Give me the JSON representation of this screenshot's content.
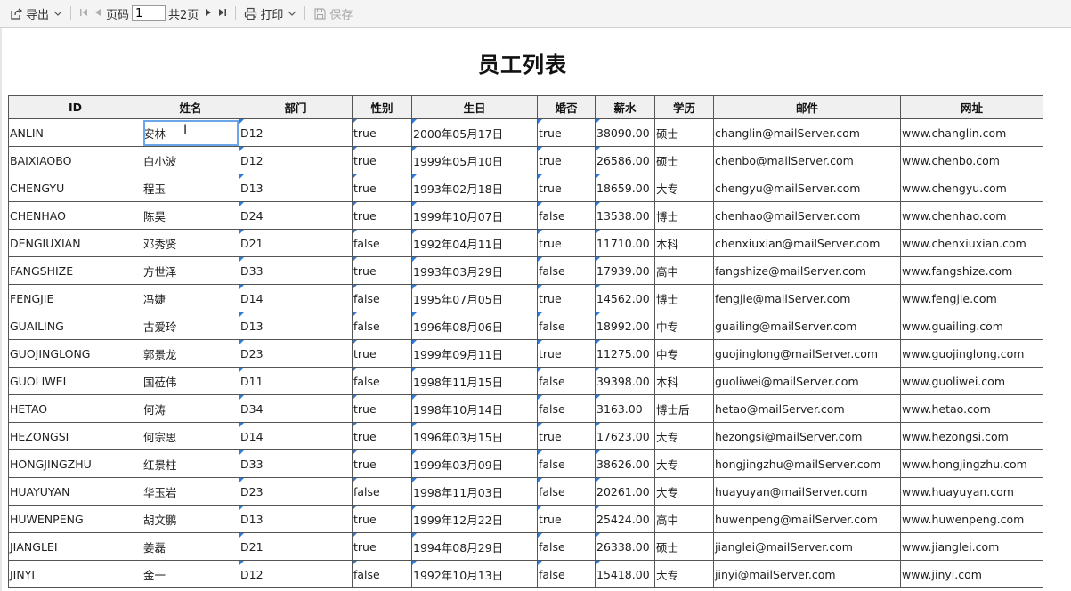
{
  "toolbar": {
    "export_label": "导出",
    "page_label": "页码",
    "page_value": "1",
    "total_label": "共2页",
    "print_label": "打印",
    "save_label": "保存"
  },
  "report": {
    "title": "员工列表",
    "columns": [
      "ID",
      "姓名",
      "部门",
      "性别",
      "生日",
      "婚否",
      "薪水",
      "学历",
      "邮件",
      "网址"
    ],
    "rows": [
      [
        "ANLIN",
        "安林",
        "D12",
        "true",
        "2000年05月17日",
        "true",
        "38090.00",
        "硕士",
        "changlin@mailServer.com",
        "www.changlin.com"
      ],
      [
        "BAIXIAOBO",
        "白小波",
        "D12",
        "true",
        "1999年05月10日",
        "true",
        "26586.00",
        "硕士",
        "chenbo@mailServer.com",
        "www.chenbo.com"
      ],
      [
        "CHENGYU",
        "程玉",
        "D13",
        "true",
        "1993年02月18日",
        "true",
        "18659.00",
        "大专",
        "chengyu@mailServer.com",
        "www.chengyu.com"
      ],
      [
        "CHENHAO",
        "陈昊",
        "D24",
        "true",
        "1999年10月07日",
        "false",
        "13538.00",
        "博士",
        "chenhao@mailServer.com",
        "www.chenhao.com"
      ],
      [
        "DENGIUXIAN",
        "邓秀贤",
        "D21",
        "false",
        "1992年04月11日",
        "true",
        "11710.00",
        "本科",
        "chenxiuxian@mailServer.com",
        "www.chenxiuxian.com"
      ],
      [
        "FANGSHIZE",
        "方世泽",
        "D33",
        "true",
        "1993年03月29日",
        "false",
        "17939.00",
        "高中",
        "fangshize@mailServer.com",
        "www.fangshize.com"
      ],
      [
        "FENGJIE",
        "冯婕",
        "D14",
        "false",
        "1995年07月05日",
        "true",
        "14562.00",
        "博士",
        "fengjie@mailServer.com",
        "www.fengjie.com"
      ],
      [
        "GUAILING",
        "古爱玲",
        "D13",
        "false",
        "1996年08月06日",
        "false",
        "18992.00",
        "中专",
        "guailing@mailServer.com",
        "www.guailing.com"
      ],
      [
        "GUOJINGLONG",
        "郭景龙",
        "D23",
        "true",
        "1999年09月11日",
        "true",
        "11275.00",
        "中专",
        "guojinglong@mailServer.com",
        "www.guojinglong.com"
      ],
      [
        "GUOLIWEI",
        "国莅伟",
        "D11",
        "false",
        "1998年11月15日",
        "false",
        "39398.00",
        "本科",
        "guoliwei@mailServer.com",
        "www.guoliwei.com"
      ],
      [
        "HETAO",
        "何涛",
        "D34",
        "true",
        "1998年10月14日",
        "false",
        "3163.00",
        "博士后",
        "hetao@mailServer.com",
        "www.hetao.com"
      ],
      [
        "HEZONGSI",
        "何宗思",
        "D14",
        "true",
        "1996年03月15日",
        "true",
        "17623.00",
        "大专",
        "hezongsi@mailServer.com",
        "www.hezongsi.com"
      ],
      [
        "HONGJINGZHU",
        "红景柱",
        "D33",
        "true",
        "1999年03月09日",
        "false",
        "38626.00",
        "大专",
        "hongjingzhu@mailServer.com",
        "www.hongjingzhu.com"
      ],
      [
        "HUAYUYAN",
        "华玉岩",
        "D23",
        "false",
        "1998年11月03日",
        "false",
        "20261.00",
        "大专",
        "huayuyan@mailServer.com",
        "www.huayuyan.com"
      ],
      [
        "HUWENPENG",
        "胡文鹏",
        "D13",
        "true",
        "1999年12月22日",
        "true",
        "25424.00",
        "高中",
        "huwenpeng@mailServer.com",
        "www.huwenpeng.com"
      ],
      [
        "JIANGLEI",
        "姜磊",
        "D21",
        "true",
        "1994年08月29日",
        "false",
        "26338.00",
        "硕士",
        "jianglei@mailServer.com",
        "www.jianglei.com"
      ],
      [
        "JINYI",
        "金一",
        "D12",
        "false",
        "1992年10月13日",
        "false",
        "15418.00",
        "大专",
        "jinyi@mailServer.com",
        "www.jinyi.com"
      ]
    ]
  }
}
